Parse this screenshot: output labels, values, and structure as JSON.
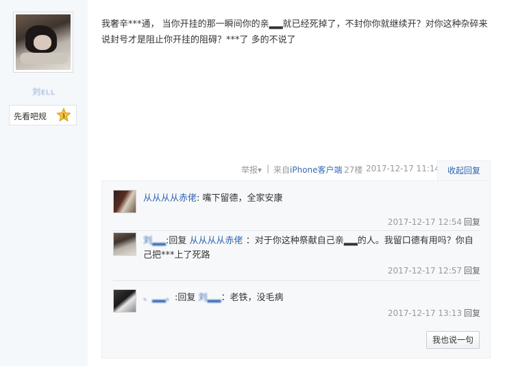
{
  "author": {
    "username": "刘ᴇʟʟ",
    "level_label": "先看吧规",
    "level_number": "1"
  },
  "post": {
    "content": "我奢辛***通， 当你开挂的那一瞬间你的亲▂▂就已经死掉了，不封你你就继续开？对你这种杂碎来说封号才是阻止你开挂的阻碍？***了 多的不说了"
  },
  "tail": {
    "report": "举报",
    "report_arrow": "▾",
    "separator": "|",
    "from_prefix": "来自",
    "client": "iPhone客户端",
    "floor": "27楼",
    "datetime": "2017-12-17 11:14",
    "collapse_label": "收起回复"
  },
  "replies": [
    {
      "user": "从从从从赤佬",
      "colon": ":",
      "text": "嘴下留德，全家安康",
      "time": "2017-12-17 12:54",
      "reply_label": "回复"
    },
    {
      "user": "刘▂▂",
      "colon": ":",
      "reply_word": "回复",
      "target": "从从从从赤佬",
      "text": " ：对于你这种祭献自己亲▂▂的人。我留口德有用吗？你自己把***上了死路",
      "time": "2017-12-17 12:57",
      "reply_label": "回复"
    },
    {
      "user": "、▂▂、",
      "colon": ":",
      "reply_word": "回复",
      "target": "刘▂▂",
      "text": "：老铁，没毛病",
      "time": "2017-12-17 13:13",
      "reply_label": "回复"
    }
  ],
  "say_button": "我也说一句"
}
